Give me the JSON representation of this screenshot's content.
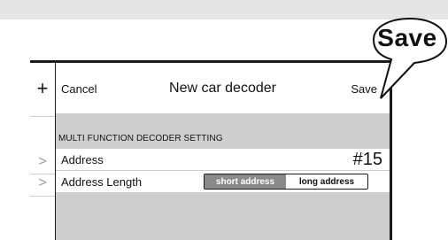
{
  "nav": {
    "cancel_label": "Cancel",
    "title": "New car decoder",
    "save_label": "Save"
  },
  "sidebar": {
    "add_symbol": "+",
    "chevron_symbol": ">"
  },
  "section": {
    "header": "MULTI FUNCTION DECODER SETTING"
  },
  "rows": {
    "address": {
      "label": "Address",
      "value": "#15"
    },
    "address_length": {
      "label": "Address Length",
      "options": [
        "short address",
        "long address"
      ],
      "selected": "short address"
    }
  },
  "callout": {
    "text": "Save"
  },
  "colors": {
    "panel_border": "#1a1a1a",
    "section_gray": "#cfcfcf",
    "segment_selected": "#8a8a8a",
    "top_strip": "#e6e6e6"
  }
}
